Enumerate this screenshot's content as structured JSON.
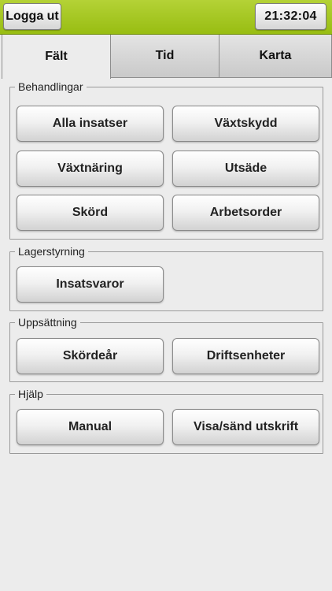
{
  "header": {
    "logout_label": "Logga ut",
    "clock": "21:32:04"
  },
  "tabs": [
    {
      "label": "Fält",
      "active": true
    },
    {
      "label": "Tid",
      "active": false
    },
    {
      "label": "Karta",
      "active": false
    }
  ],
  "groups": {
    "behandlingar": {
      "title": "Behandlingar",
      "buttons": [
        "Alla insatser",
        "Växtskydd",
        "Växtnäring",
        "Utsäde",
        "Skörd",
        "Arbetsorder"
      ]
    },
    "lagerstyrning": {
      "title": "Lagerstyrning",
      "buttons": [
        "Insatsvaror"
      ]
    },
    "uppsattning": {
      "title": "Uppsättning",
      "buttons": [
        "Skördeår",
        "Driftsenheter"
      ]
    },
    "hjalp": {
      "title": "Hjälp",
      "buttons": [
        "Manual",
        "Visa/sänd utskrift"
      ]
    }
  },
  "colors": {
    "header_green": "#a6c823",
    "background": "#ececec"
  }
}
